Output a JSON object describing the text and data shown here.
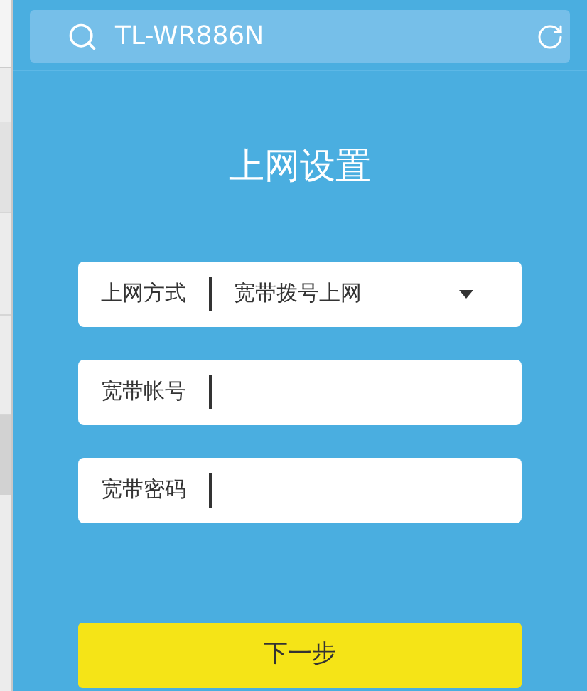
{
  "address_bar": {
    "value": "TL-WR886N"
  },
  "title": "上网设置",
  "fields": [
    {
      "kind": "select",
      "label": "上网方式",
      "value": "宽带拨号上网"
    },
    {
      "kind": "input",
      "label": "宽带帐号"
    },
    {
      "kind": "input",
      "label": "宽带密码"
    }
  ],
  "next_button": "下一步"
}
